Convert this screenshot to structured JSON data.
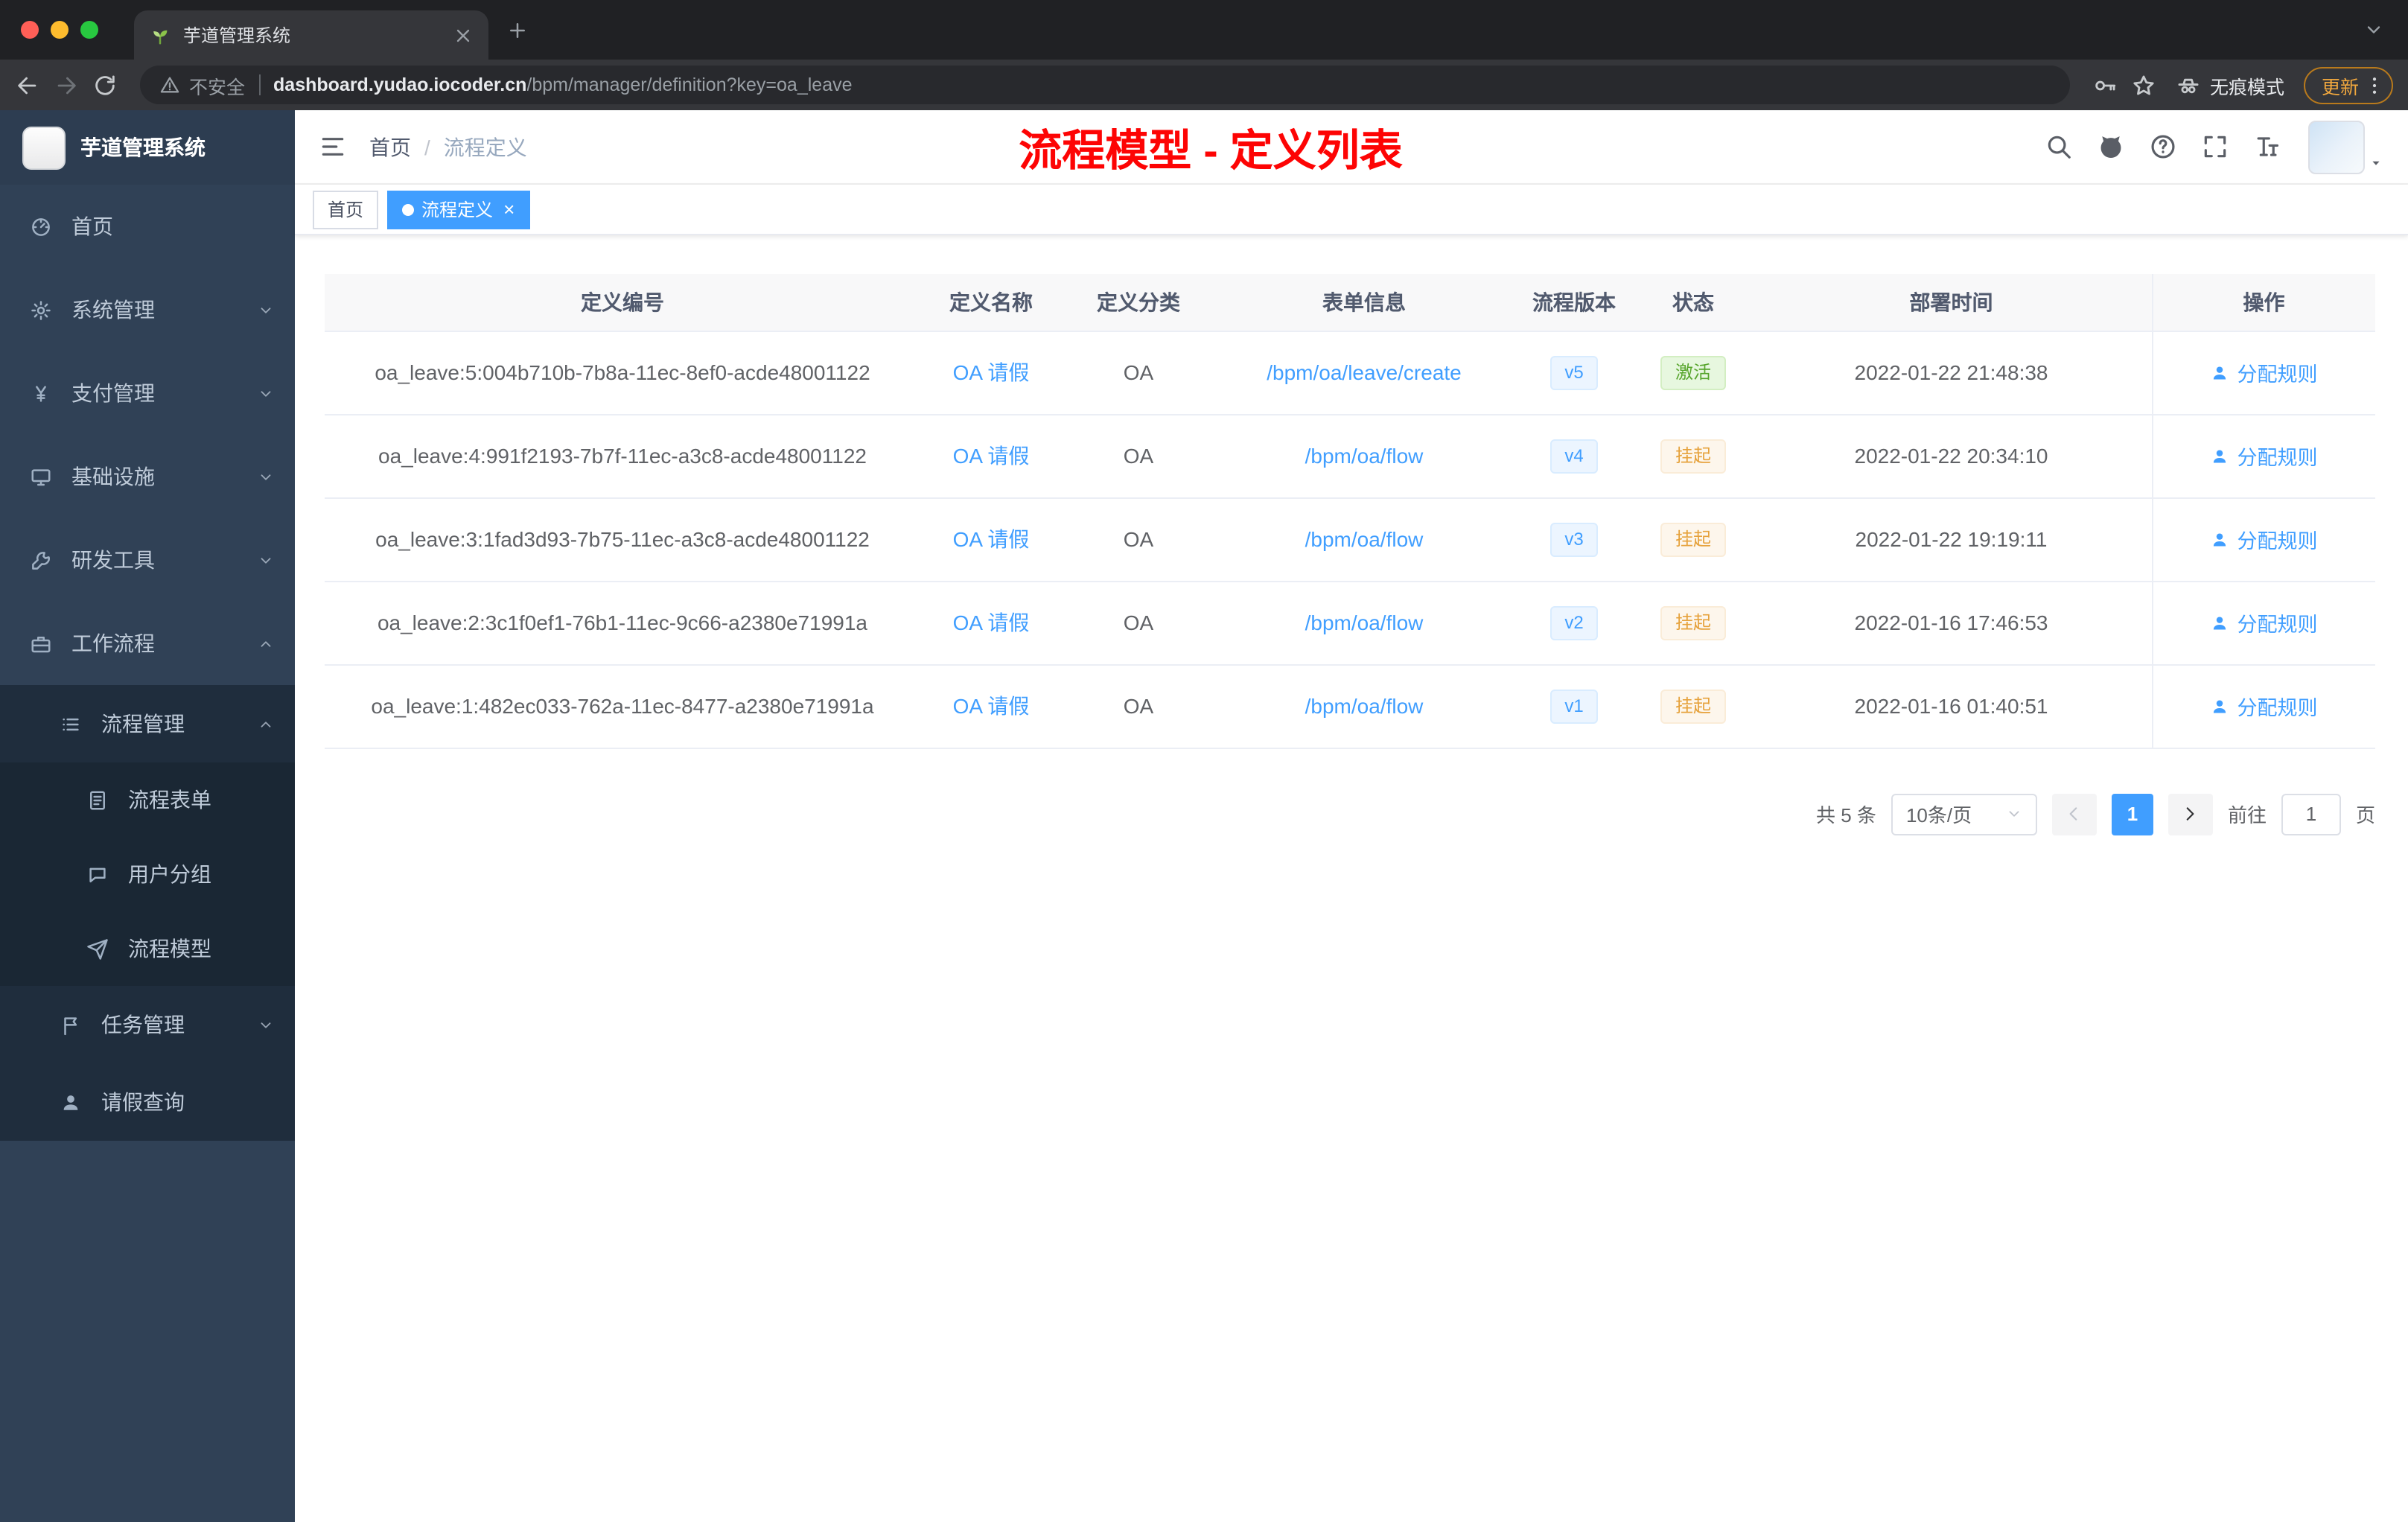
{
  "browser": {
    "tab": {
      "title": "芋道管理系统"
    },
    "toolbar": {
      "security_label": "不安全",
      "url_host": "dashboard.yudao.iocoder.cn",
      "url_path": "/bpm/manager/definition?key=oa_leave",
      "incognito_label": "无痕模式",
      "update_label": "更新"
    }
  },
  "sidebar": {
    "logo_title": "芋道管理系统",
    "items": [
      {
        "key": "home",
        "label": "首页",
        "icon": "gauge",
        "level": 1
      },
      {
        "key": "system-management",
        "label": "系统管理",
        "icon": "gear",
        "level": 1,
        "chevron": "down"
      },
      {
        "key": "payment-management",
        "label": "支付管理",
        "icon": "yen",
        "level": 1,
        "chevron": "down"
      },
      {
        "key": "infrastructure",
        "label": "基础设施",
        "icon": "monitor",
        "level": 1,
        "chevron": "down"
      },
      {
        "key": "dev-tools",
        "label": "研发工具",
        "icon": "wrench",
        "level": 1,
        "chevron": "down"
      },
      {
        "key": "workflow",
        "label": "工作流程",
        "icon": "briefcase",
        "level": 1,
        "chevron": "up"
      },
      {
        "key": "process-management",
        "label": "流程管理",
        "icon": "list",
        "level": 2,
        "chevron": "up",
        "sub": true
      },
      {
        "key": "process-form",
        "label": "流程表单",
        "icon": "doc",
        "level": 3,
        "sub": true
      },
      {
        "key": "user-group",
        "label": "用户分组",
        "icon": "chat",
        "level": 3,
        "sub": true
      },
      {
        "key": "process-model",
        "label": "流程模型",
        "icon": "plane",
        "level": 3,
        "sub": true
      },
      {
        "key": "task-management",
        "label": "任务管理",
        "icon": "flag",
        "level": 2,
        "chevron": "down",
        "sub": true
      },
      {
        "key": "leave-query",
        "label": "请假查询",
        "icon": "person",
        "level": 2,
        "sub": true
      }
    ]
  },
  "navbar": {
    "breadcrumb": [
      "首页",
      "流程定义"
    ],
    "page_title": "流程模型 - 定义列表"
  },
  "tags": [
    {
      "key": "home",
      "label": "首页",
      "active": false,
      "closable": false
    },
    {
      "key": "process-definition",
      "label": "流程定义",
      "active": true,
      "closable": true
    }
  ],
  "table": {
    "columns": [
      "定义编号",
      "定义名称",
      "定义分类",
      "表单信息",
      "流程版本",
      "状态",
      "部署时间",
      "操作"
    ],
    "action_label": "分配规则",
    "rows": [
      {
        "id": "oa_leave:5:004b710b-7b8a-11ec-8ef0-acde48001122",
        "name": "OA 请假",
        "category": "OA",
        "form": "/bpm/oa/leave/create",
        "version": "v5",
        "status": "激活",
        "status_type": "success",
        "deploy_time": "2022-01-22 21:48:38"
      },
      {
        "id": "oa_leave:4:991f2193-7b7f-11ec-a3c8-acde48001122",
        "name": "OA 请假",
        "category": "OA",
        "form": "/bpm/oa/flow",
        "version": "v4",
        "status": "挂起",
        "status_type": "warning",
        "deploy_time": "2022-01-22 20:34:10"
      },
      {
        "id": "oa_leave:3:1fad3d93-7b75-11ec-a3c8-acde48001122",
        "name": "OA 请假",
        "category": "OA",
        "form": "/bpm/oa/flow",
        "version": "v3",
        "status": "挂起",
        "status_type": "warning",
        "deploy_time": "2022-01-22 19:19:11"
      },
      {
        "id": "oa_leave:2:3c1f0ef1-76b1-11ec-9c66-a2380e71991a",
        "name": "OA 请假",
        "category": "OA",
        "form": "/bpm/oa/flow",
        "version": "v2",
        "status": "挂起",
        "status_type": "warning",
        "deploy_time": "2022-01-16 17:46:53"
      },
      {
        "id": "oa_leave:1:482ec033-762a-11ec-8477-a2380e71991a",
        "name": "OA 请假",
        "category": "OA",
        "form": "/bpm/oa/flow",
        "version": "v1",
        "status": "挂起",
        "status_type": "warning",
        "deploy_time": "2022-01-16 01:40:51"
      }
    ]
  },
  "pagination": {
    "total_label": "共 5 条",
    "page_size_label": "10条/页",
    "current_page": "1",
    "goto_prefix": "前往",
    "goto_value": "1",
    "goto_suffix": "页"
  },
  "colors": {
    "accent": "#409EFF",
    "title_red": "#FD0404",
    "success": "#67C23A",
    "warning": "#E6A23C",
    "sidebar_bg": "#304156",
    "submenu_bg": "#1F2D3D"
  }
}
